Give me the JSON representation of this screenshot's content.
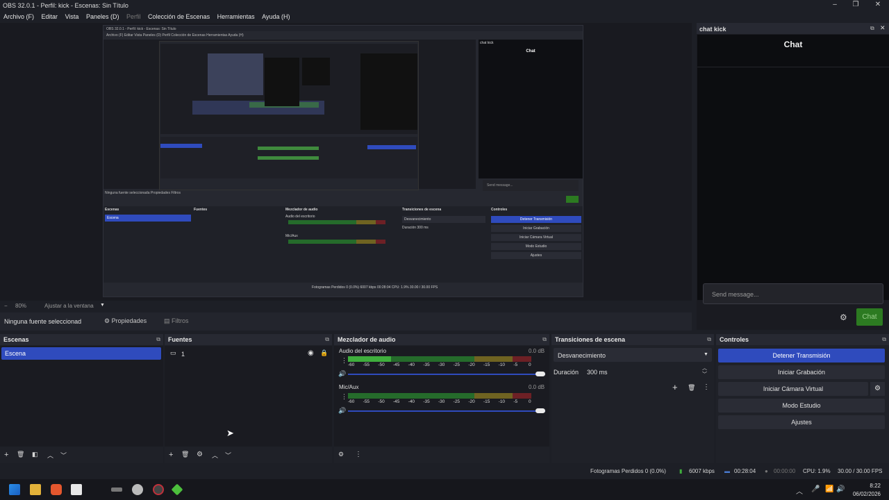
{
  "window": {
    "title": "OBS 32.0.1 - Perfil: kick - Escenas: Sin Título"
  },
  "menu": [
    "Archivo (F)",
    "Editar",
    "Vista",
    "Paneles (D)",
    "Perfil",
    "Colección de Escenas",
    "Herramientas",
    "Ayuda (H)"
  ],
  "zoom": {
    "minus": "−",
    "level": "80%",
    "fit": "Ajustar a la ventana"
  },
  "source_bar": {
    "selected": "Ninguna fuente seleccionad",
    "props": "Propiedades",
    "filters": "Filtros"
  },
  "chat": {
    "dock_title": "chat kick",
    "panel_title": "Chat",
    "placeholder": "Send message...",
    "send_label": "Chat",
    "colors": {
      "send": "#2c7a21"
    }
  },
  "scenes": {
    "title": "Escenas",
    "items": [
      "Escena"
    ]
  },
  "sources": {
    "title": "Fuentes",
    "items": [
      "1"
    ]
  },
  "mixer": {
    "title": "Mezclador de audio",
    "channels": [
      {
        "name": "Audio del escritorio",
        "db": "0.0 dB"
      },
      {
        "name": "Mic/Aux",
        "db": "0.0 dB"
      }
    ],
    "scale": [
      "-60",
      "-55",
      "-50",
      "-45",
      "-40",
      "-35",
      "-30",
      "-25",
      "-20",
      "-15",
      "-10",
      "-5",
      "0"
    ]
  },
  "transitions": {
    "title": "Transiciones de escena",
    "selected": "Desvanecimiento",
    "duration_label": "Duración",
    "duration_value": "300 ms"
  },
  "controls": {
    "title": "Controles",
    "buttons": [
      "Detener Transmisión",
      "Iniciar Grabación",
      "Iniciar Cámara Virtual",
      "Modo Estudio",
      "Ajustes"
    ],
    "colors": {
      "primary": "#2f4bbd"
    }
  },
  "status": {
    "frames": "Fotogramas Perdidos 0 (0.0%)",
    "kbps": "6007 kbps",
    "live_time": "00:28:04",
    "rec_time": "00:00:00",
    "cpu": "CPU: 1.9%",
    "fps": "30.00 / 30.00 FPS"
  },
  "taskbar": {
    "time": "8:22",
    "date": "06/02/2026"
  },
  "preview_mini": {
    "title": "OBS 32.0.1 - Perfil: kick - Escenas: Sin Título",
    "menu": "Archivo (F)   Editar   Vista   Paneles (D)   Perfil   Colección de Escenas   Herramientas   Ayuda (H)",
    "chat_title": "chat kick",
    "chat_panel": "Chat",
    "placeholder": "Send message...",
    "source_bar": "Ninguna fuente seleccionada   Propiedades   Filtros",
    "docks": [
      "Escenas",
      "Fuentes",
      "Mezclador de audio",
      "Transiciones de escena",
      "Controles"
    ],
    "scene": "Escena",
    "mixer_ch": [
      "Audio del escritorio",
      "Mic/Aux"
    ],
    "transition": "Desvanecimiento",
    "duration": "Duración   300 ms",
    "buttons": [
      "Detener Transmisión",
      "Iniciar Grabación",
      "Iniciar Cámara Virtual",
      "Modo Estudio",
      "Ajustes"
    ],
    "status": "Fotogramas Perdidos 0 (0.0%)   6007 kbps   00:28:04   CPU: 1.9%   30.00 / 30.00 FPS"
  }
}
